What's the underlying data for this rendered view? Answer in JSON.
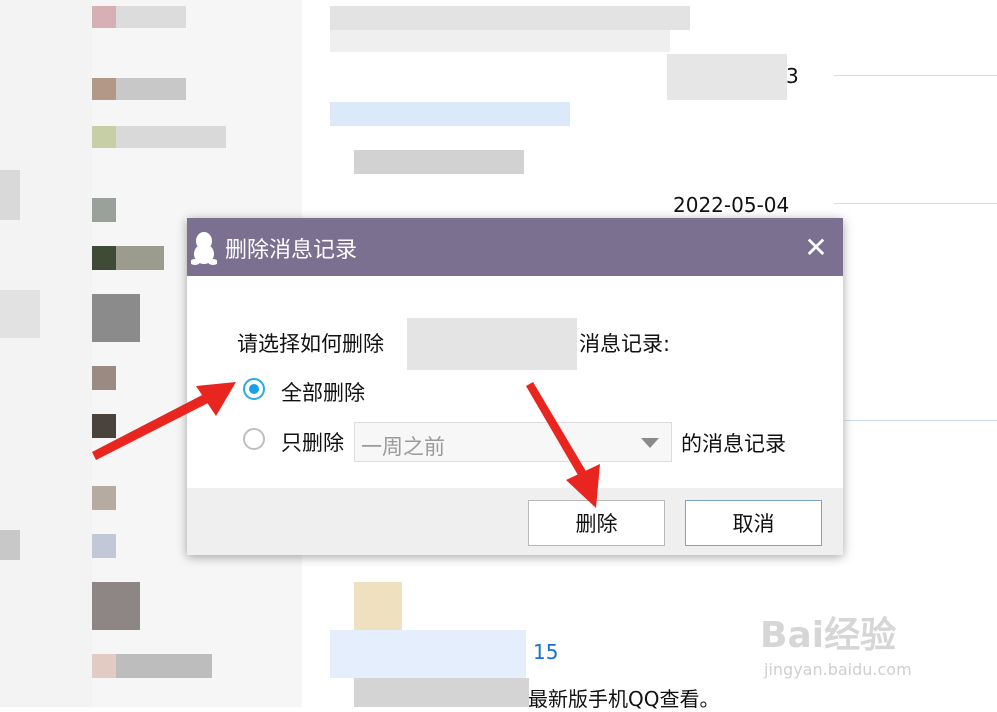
{
  "background": {
    "date_label": "2022-05-04",
    "partial_char": "3",
    "link_number": "15",
    "message_fragment": "最新版手机QQ查看。"
  },
  "dialog": {
    "title": "删除消息记录",
    "close_glyph": "✕",
    "prompt_start": "请选择如何删除",
    "prompt_end": "消息记录:",
    "option_all_label": "全部删除",
    "option_partial_label": "只删除",
    "option_all_checked": true,
    "period_select_value": "一周之前",
    "period_suffix": "的消息记录",
    "delete_button_label": "删除",
    "cancel_button_label": "取消"
  },
  "watermark": {
    "brand": "Bai经验",
    "url": "jingyan.baidu.com"
  },
  "colors": {
    "titlebar": "#7c7090",
    "radio_accent": "#1aa0e6",
    "arrow": "#e8251f",
    "link": "#1a6fd6"
  },
  "icons": {
    "titlebar_icon": "qq-penguin-icon",
    "close": "close-icon",
    "dropdown": "chevron-down-icon"
  }
}
